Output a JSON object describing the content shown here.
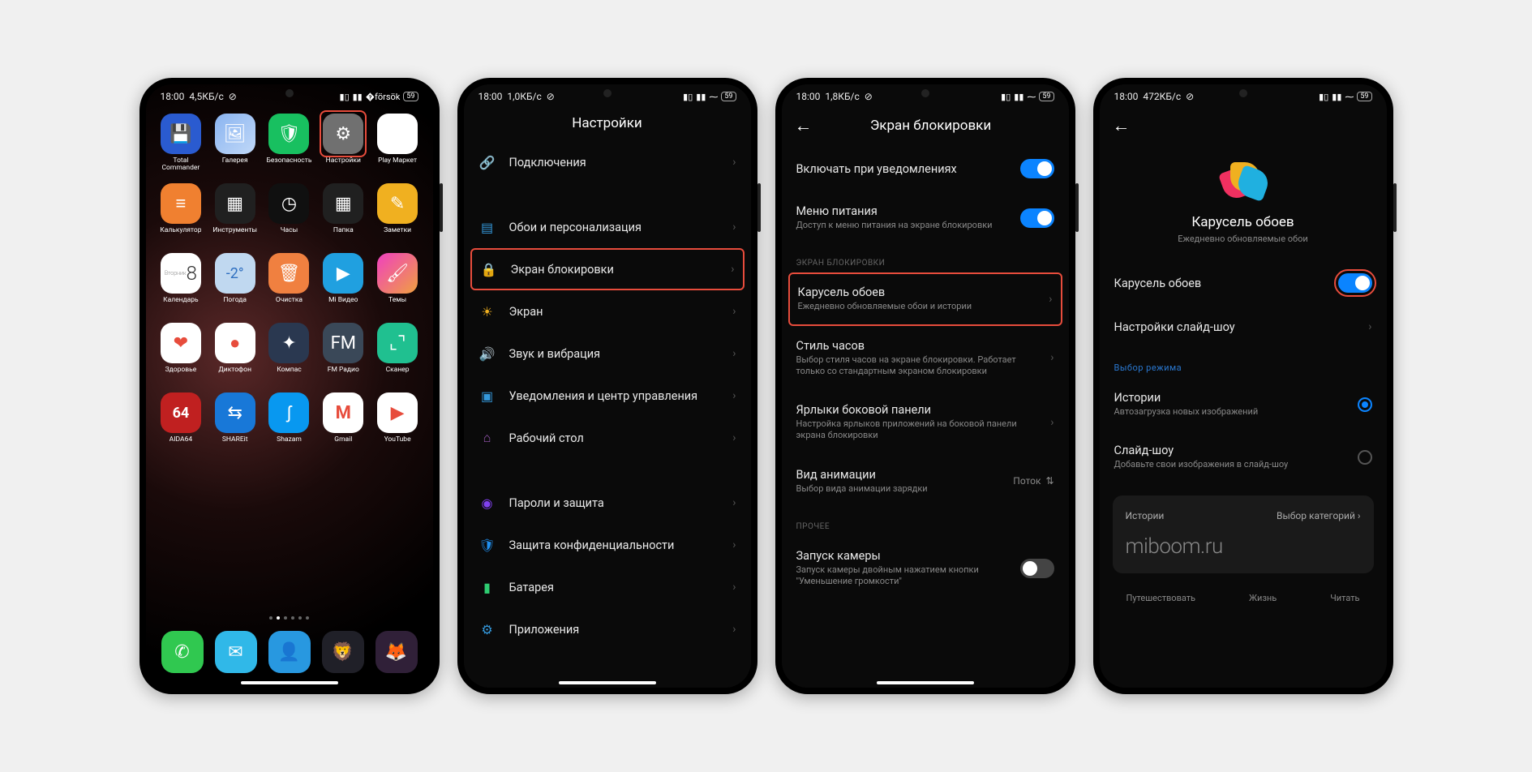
{
  "status": {
    "time": "18:00",
    "net1": "4,5КБ/с",
    "net2": "1,0КБ/с",
    "net3": "1,8КБ/с",
    "net4": "472КБ/с",
    "battery": "59"
  },
  "screen1": {
    "apps": [
      {
        "label": "Total Commander",
        "icon": "save-icon",
        "bg": "#2a5bd0"
      },
      {
        "label": "Галерея",
        "icon": "gallery-icon",
        "bg": "linear-gradient(135deg,#8ab4f0,#c0d8f8)"
      },
      {
        "label": "Безопасность",
        "icon": "shield-icon",
        "bg": "#18c060"
      },
      {
        "label": "Настройки",
        "icon": "gear-icon",
        "bg": "#707070",
        "hilite": true
      },
      {
        "label": "Play Маркет",
        "icon": "play-store-icon",
        "bg": "#fff"
      },
      {
        "label": "Калькулятор",
        "icon": "calculator-icon",
        "bg": "#f08030"
      },
      {
        "label": "Инструменты",
        "icon": "folder-icon",
        "bg": "#202020"
      },
      {
        "label": "Часы",
        "icon": "clock-icon",
        "bg": "#101010"
      },
      {
        "label": "Папка",
        "icon": "folder-icon",
        "bg": "#202020"
      },
      {
        "label": "Заметки",
        "icon": "notes-icon",
        "bg": "#f0b020"
      },
      {
        "label": "Календарь",
        "icon": "calendar-icon",
        "bg": "#fff",
        "text": "8",
        "badge": "Вторник"
      },
      {
        "label": "Погода",
        "icon": "weather-icon",
        "bg": "#c0d8f0",
        "text": "-2°"
      },
      {
        "label": "Очистка",
        "icon": "trash-icon",
        "bg": "#f08040"
      },
      {
        "label": "Mi Видео",
        "icon": "video-icon",
        "bg": "#20a0e0"
      },
      {
        "label": "Темы",
        "icon": "themes-icon",
        "bg": "linear-gradient(135deg,#f040c0,#f0a040)"
      },
      {
        "label": "Здоровье",
        "icon": "health-icon",
        "bg": "#fff"
      },
      {
        "label": "Диктофон",
        "icon": "recorder-icon",
        "bg": "#fff"
      },
      {
        "label": "Компас",
        "icon": "compass-icon",
        "bg": "#2a3850"
      },
      {
        "label": "FM Радио",
        "icon": "radio-icon",
        "bg": "#3a4858"
      },
      {
        "label": "Сканер",
        "icon": "scanner-icon",
        "bg": "#20c090"
      },
      {
        "label": "AIDA64",
        "icon": "aida-icon",
        "bg": "#c02020",
        "text": "64"
      },
      {
        "label": "SHAREit",
        "icon": "shareit-icon",
        "bg": "#1878d8"
      },
      {
        "label": "Shazam",
        "icon": "shazam-icon",
        "bg": "#0898f0"
      },
      {
        "label": "Gmail",
        "icon": "gmail-icon",
        "bg": "#fff"
      },
      {
        "label": "YouTube",
        "icon": "youtube-icon",
        "bg": "#fff"
      }
    ],
    "dock": [
      {
        "icon": "phone-icon",
        "bg": "#30c850"
      },
      {
        "icon": "messages-icon",
        "bg": "#30b8e8"
      },
      {
        "icon": "contacts-icon",
        "bg": "#2898e0"
      },
      {
        "icon": "browser-icon",
        "bg": "#202028"
      },
      {
        "icon": "firefox-icon",
        "bg": "#302038"
      }
    ]
  },
  "screen2": {
    "title": "Настройки",
    "items": [
      {
        "icon": "link-icon",
        "color": "#e74c3c",
        "label": "Подключения"
      },
      {
        "icon": "wallpaper-icon",
        "color": "#3498db",
        "label": "Обои и персонализация",
        "spacer_before": true
      },
      {
        "icon": "lock-icon",
        "color": "#e74c3c",
        "label": "Экран блокировки",
        "hilite": true
      },
      {
        "icon": "brightness-icon",
        "color": "#f0b020",
        "label": "Экран"
      },
      {
        "icon": "sound-icon",
        "color": "#2ecc71",
        "label": "Звук и вибрация"
      },
      {
        "icon": "notifications-icon",
        "color": "#3498db",
        "label": "Уведомления и центр управления"
      },
      {
        "icon": "home-icon",
        "color": "#9b59b6",
        "label": "Рабочий стол"
      },
      {
        "icon": "fingerprint-icon",
        "color": "#8040f0",
        "label": "Пароли и защита",
        "spacer_before": true
      },
      {
        "icon": "privacy-icon",
        "color": "#2090f0",
        "label": "Защита конфиденциальности"
      },
      {
        "icon": "battery-icon",
        "color": "#2ecc71",
        "label": "Батарея"
      },
      {
        "icon": "apps-icon",
        "color": "#3498db",
        "label": "Приложения"
      }
    ]
  },
  "screen3": {
    "title": "Экран блокировки",
    "top": [
      {
        "label": "Включать при уведомлениях",
        "toggle": true
      },
      {
        "label": "Меню питания",
        "sub": "Доступ к меню питания на экране блокировки",
        "toggle": true
      }
    ],
    "section1": "ЭКРАН БЛОКИРОВКИ",
    "lock_items": [
      {
        "label": "Карусель обоев",
        "sub": "Ежедневно обновляемые обои и истории",
        "hilite": true
      },
      {
        "label": "Стиль часов",
        "sub": "Выбор стиля часов на экране блокировки. Работает только со стандартным экраном блокировки"
      },
      {
        "label": "Ярлыки боковой панели",
        "sub": "Настройка ярлыков приложений на боковой панели экрана блокировки"
      },
      {
        "label": "Вид анимации",
        "sub": "Выбор вида анимации зарядки",
        "trail": "Поток",
        "trail_icon": "updown-icon"
      }
    ],
    "section2": "ПРОЧЕЕ",
    "other": [
      {
        "label": "Запуск камеры",
        "sub": "Запуск камеры двойным нажатием кнопки \"Уменьшение громкости\"",
        "off": true
      }
    ]
  },
  "screen4": {
    "hero_title": "Карусель обоев",
    "hero_sub": "Ежедневно обновляемые обои",
    "toggle_label": "Карусель обоев",
    "slideshow_label": "Настройки слайд-шоу",
    "mode_header": "Выбор режима",
    "modes": [
      {
        "label": "Истории",
        "sub": "Автозагрузка новых изображений",
        "on": true
      },
      {
        "label": "Слайд-шоу",
        "sub": "Добавьте свои изображения в слайд-шоу",
        "on": false
      }
    ],
    "card_left": "Истории",
    "card_right": "Выбор категорий",
    "card_brand": "miboom.ru",
    "tabs": [
      "Путешествовать",
      "Жизнь",
      "Читать"
    ]
  }
}
